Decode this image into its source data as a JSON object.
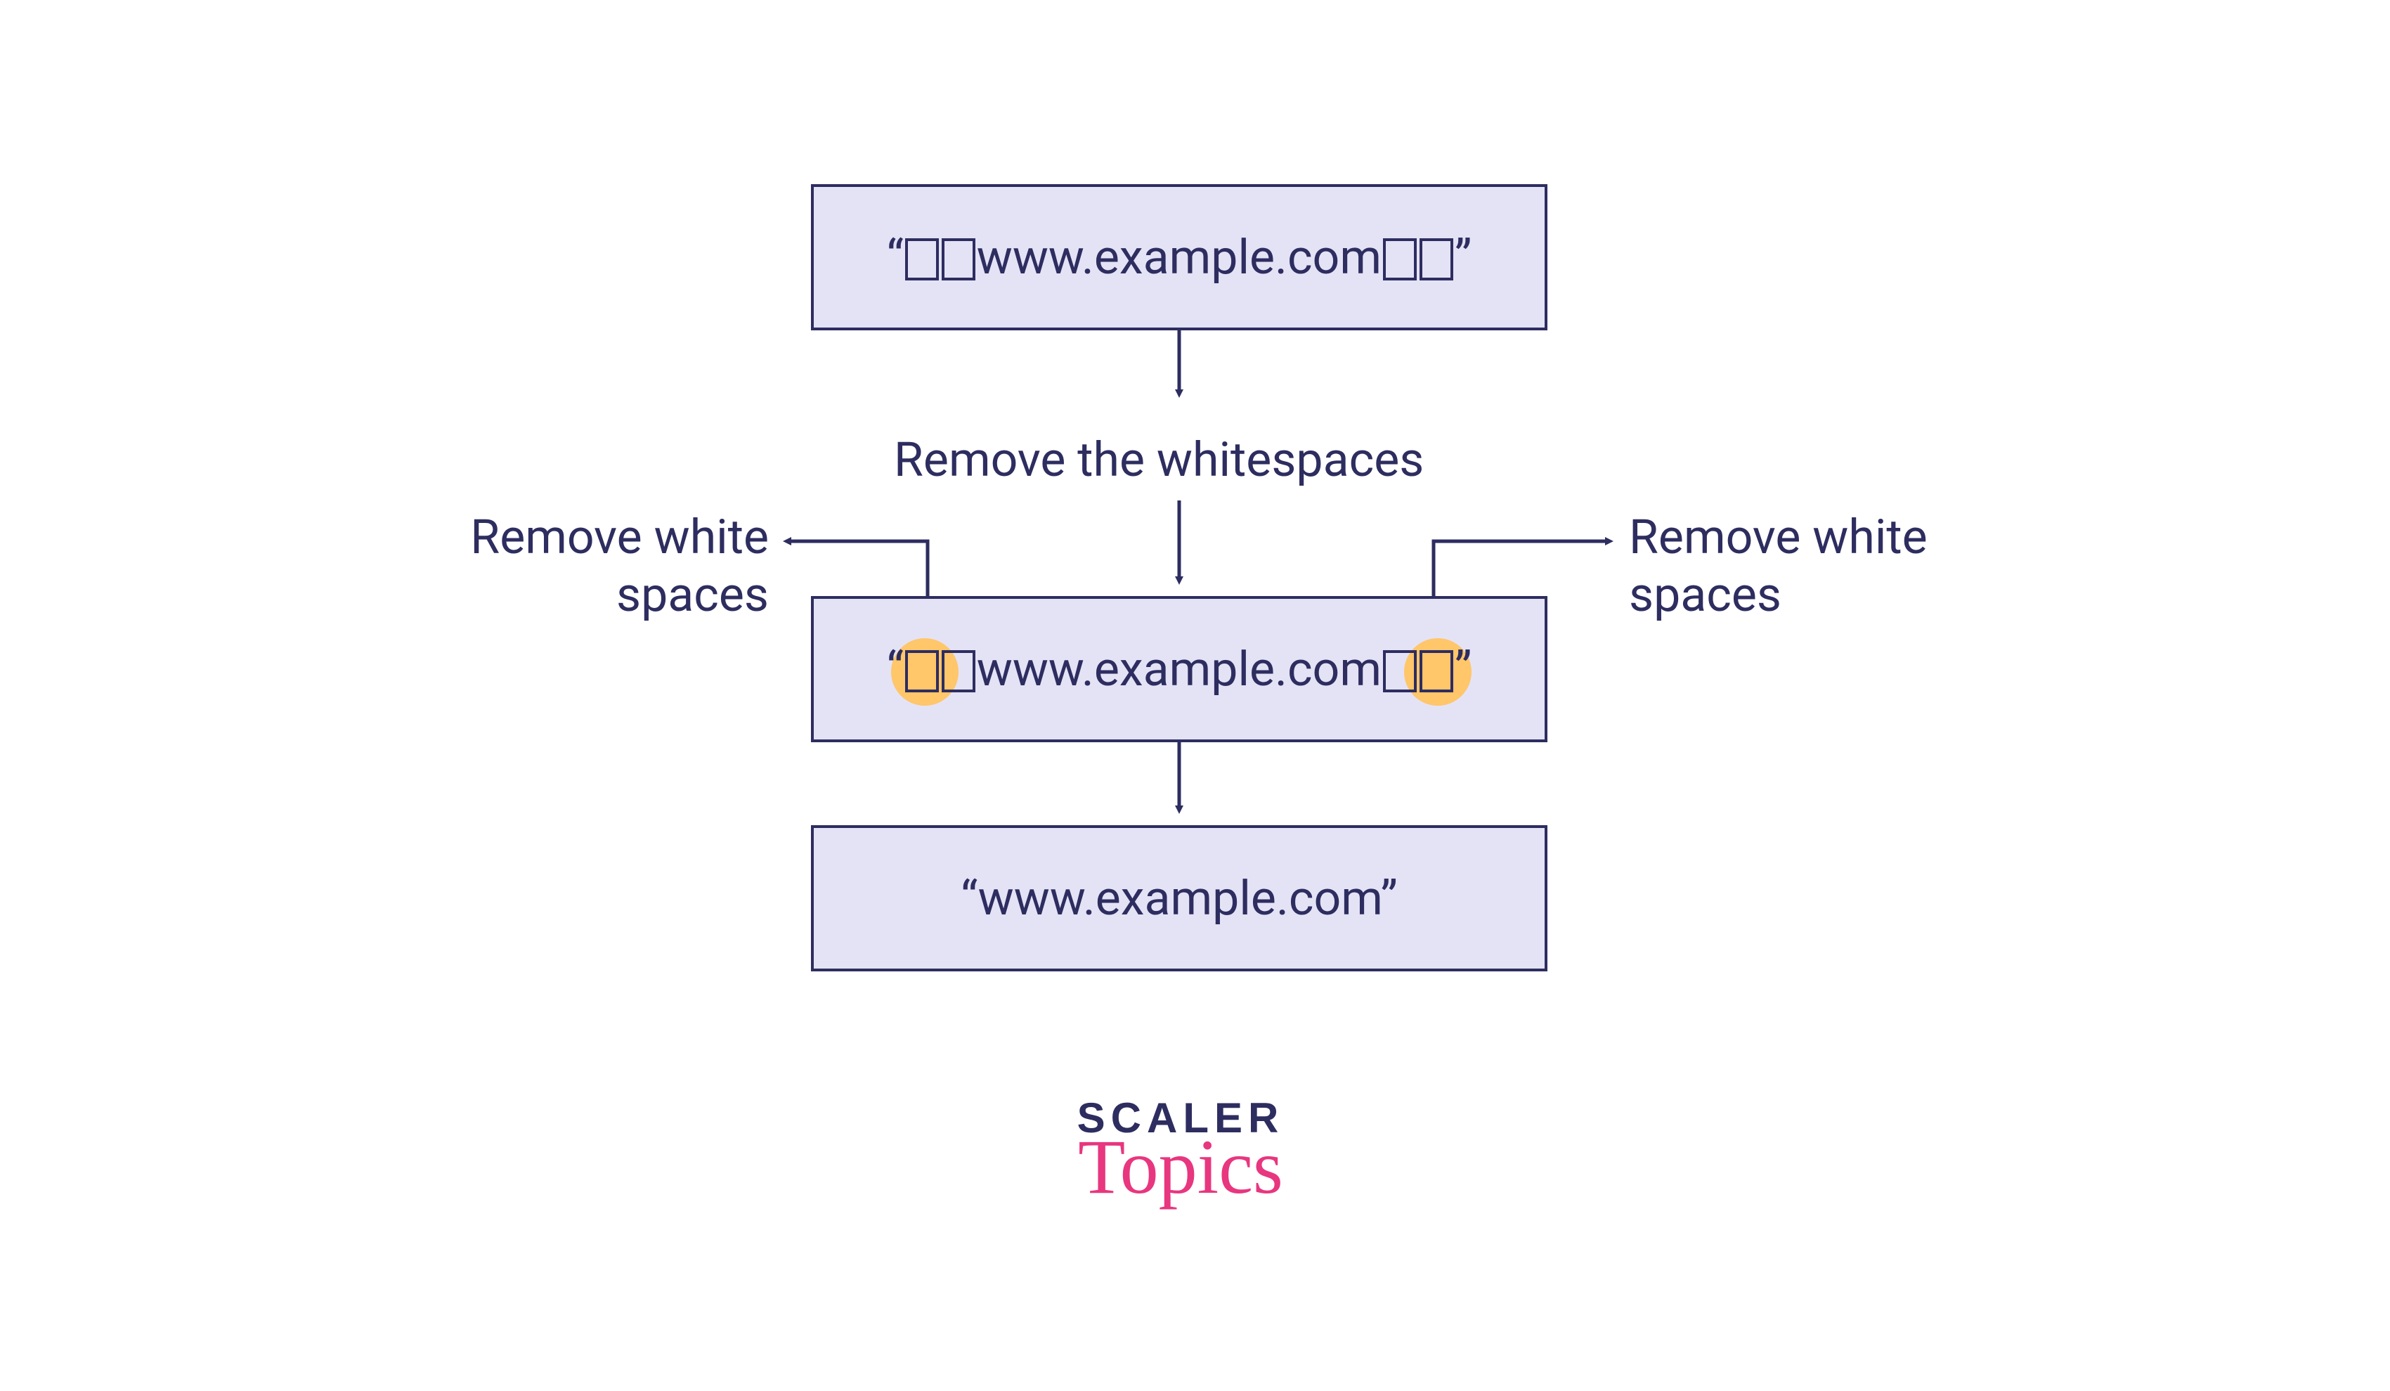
{
  "diagram": {
    "box1_text": "www.example.com",
    "box2_text": "www.example.com",
    "box3_text": "www.example.com",
    "quote_open": "“",
    "quote_close": "”",
    "label_center": "Remove the whitespaces",
    "label_left_a": "Remove white",
    "label_left_b": "spaces",
    "label_right_a": "Remove white",
    "label_right_b": "spaces",
    "whitespace_count_leading": 2,
    "whitespace_count_trailing": 2
  },
  "brand": {
    "line1": "SCALER",
    "line2": "Topics"
  },
  "colors": {
    "box_fill": "#E4E3F6",
    "box_border": "#2E2D60",
    "text": "#2E2D60",
    "highlight": "#FFC66A",
    "accent": "#E8367F"
  }
}
